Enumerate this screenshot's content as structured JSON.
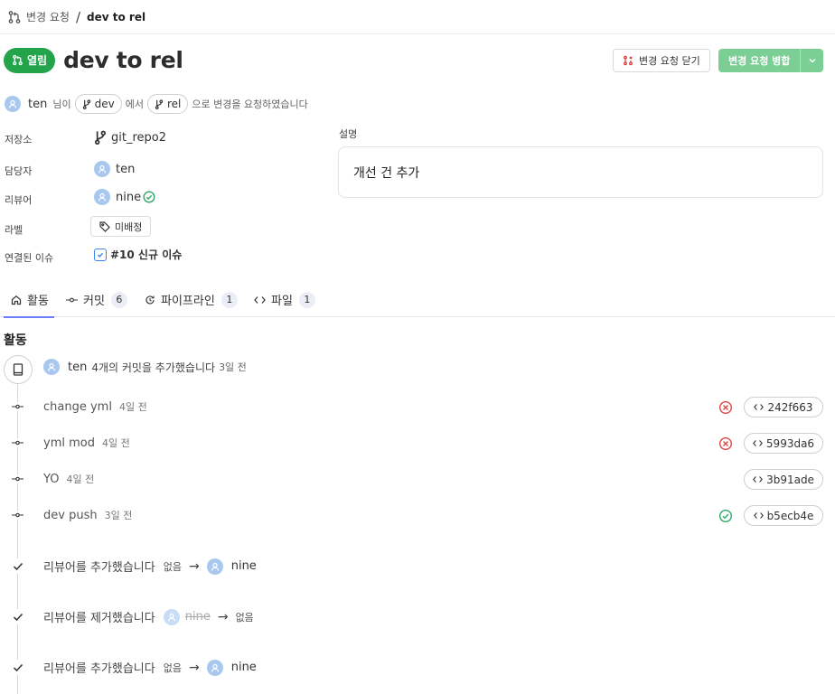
{
  "breadcrumb": {
    "parent": "변경 요청",
    "separator": "/",
    "current": "dev to rel"
  },
  "header": {
    "state": "열림",
    "title": "dev to rel"
  },
  "actions": {
    "close": "변경 요청 닫기",
    "merge": "변경 요청 병합"
  },
  "byline": {
    "author": "ten",
    "suffix1": "님이",
    "source_branch": "dev",
    "mid": "에서",
    "target_branch": "rel",
    "suffix2": "으로 변경을 요청하였습니다"
  },
  "meta": {
    "repo_label": "저장소",
    "repo": "git_repo2",
    "assignee_label": "담당자",
    "assignee": "ten",
    "reviewer_label": "리뷰어",
    "reviewer": "nine",
    "labels_label": "라벨",
    "labels_value": "미배정",
    "linked_label": "연결된 이슈",
    "linked_issue": "#10 신규 이슈"
  },
  "description": {
    "label": "설명",
    "text": "개선 건 추가"
  },
  "tabs": [
    {
      "label": "활동",
      "count": "",
      "icon": "home-icon"
    },
    {
      "label": "커밋",
      "count": "6",
      "icon": "commit-icon"
    },
    {
      "label": "파이프라인",
      "count": "1",
      "icon": "pipeline-icon"
    },
    {
      "label": "파일",
      "count": "1",
      "icon": "code-icon"
    }
  ],
  "activity": {
    "title": "활동",
    "push": {
      "user": "ten",
      "text": "4개의 커밋을 추가했습니다",
      "time": "3일 전"
    },
    "commits": [
      {
        "message": "change yml",
        "time": "4일 전",
        "status": "failed",
        "sha": "242f663"
      },
      {
        "message": "yml mod",
        "time": "4일 전",
        "status": "failed",
        "sha": "5993da6"
      },
      {
        "message": "YO",
        "time": "4일 전",
        "status": "none",
        "sha": "3b91ade"
      },
      {
        "message": "dev push",
        "time": "3일 전",
        "status": "success",
        "sha": "b5ecb4e"
      }
    ],
    "events": [
      {
        "text": "리뷰어를 추가했습니다",
        "from": "없음",
        "arrow": "→",
        "to": "nine"
      },
      {
        "text": "리뷰어를 제거했습니다",
        "from": "nine",
        "arrow": "→",
        "to": "없음"
      },
      {
        "text": "리뷰어를 추가했습니다",
        "from": "없음",
        "arrow": "→",
        "to": "nine"
      }
    ]
  },
  "colors": {
    "open": "#23a34a",
    "merge": "#7ccf94",
    "tab_active": "#6b7cff",
    "failed": "#e04646",
    "success": "#2ea86a"
  }
}
